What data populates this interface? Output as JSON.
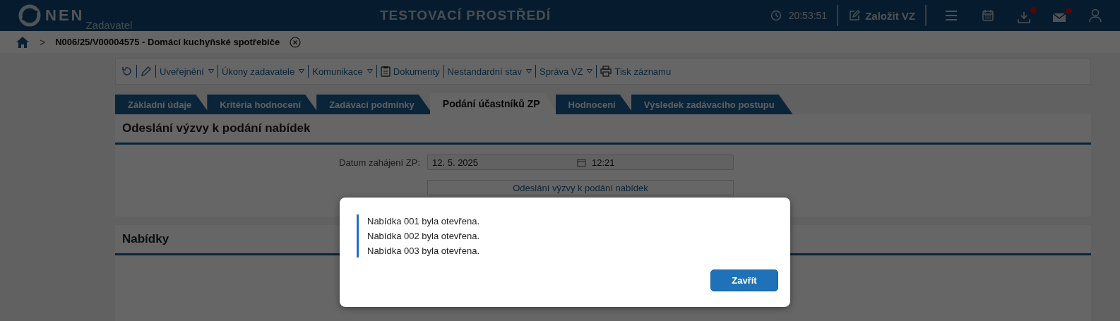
{
  "header": {
    "logo": "NEN",
    "role": "Zadavatel",
    "environment": "TESTOVACÍ PROSTŘEDÍ",
    "time": "20:53:51",
    "create_button": "Založit VZ",
    "download_badge": true,
    "mail_badge": true
  },
  "breadcrumb": {
    "separator": ">",
    "item": "N006/25/V00004575 - Domácí kuchyňské spotřebiče"
  },
  "toolbar": [
    {
      "kind": "refresh"
    },
    {
      "kind": "edit"
    },
    {
      "kind": "menu",
      "label": "Uveřejnění"
    },
    {
      "kind": "menu",
      "label": "Úkony zadavatele"
    },
    {
      "kind": "menu",
      "label": "Komunikace"
    },
    {
      "kind": "documents",
      "label": "Dokumenty"
    },
    {
      "kind": "menu",
      "label": "Nestandardní stav"
    },
    {
      "kind": "menu",
      "label": "Správa VZ"
    },
    {
      "kind": "print",
      "label": "Tisk záznamu"
    }
  ],
  "tabs": [
    {
      "label": "Základní údaje",
      "selected": false
    },
    {
      "label": "Kritéria hodnocení",
      "selected": false
    },
    {
      "label": "Zadávací podmínky",
      "selected": false
    },
    {
      "label": "Podání účastníků ZP",
      "selected": true
    },
    {
      "label": "Hodnocení",
      "selected": false
    },
    {
      "label": "Výsledek zadávacího postupu",
      "selected": false
    }
  ],
  "sections": [
    {
      "title": "Odeslání výzvy k podání nabídek",
      "field": {
        "label": "Datum zahájení ZP:",
        "date": "12. 5. 2025",
        "time": "12:21"
      },
      "button": "Odeslání výzvy k podání nabídek"
    },
    {
      "title": "Nabídky"
    }
  ],
  "dialog": {
    "messages": [
      "Nabídka 001 byla otevřena.",
      "Nabídka 002 byla otevřena.",
      "Nabídka 003 byla otevřena."
    ],
    "button": "Zavřít"
  }
}
